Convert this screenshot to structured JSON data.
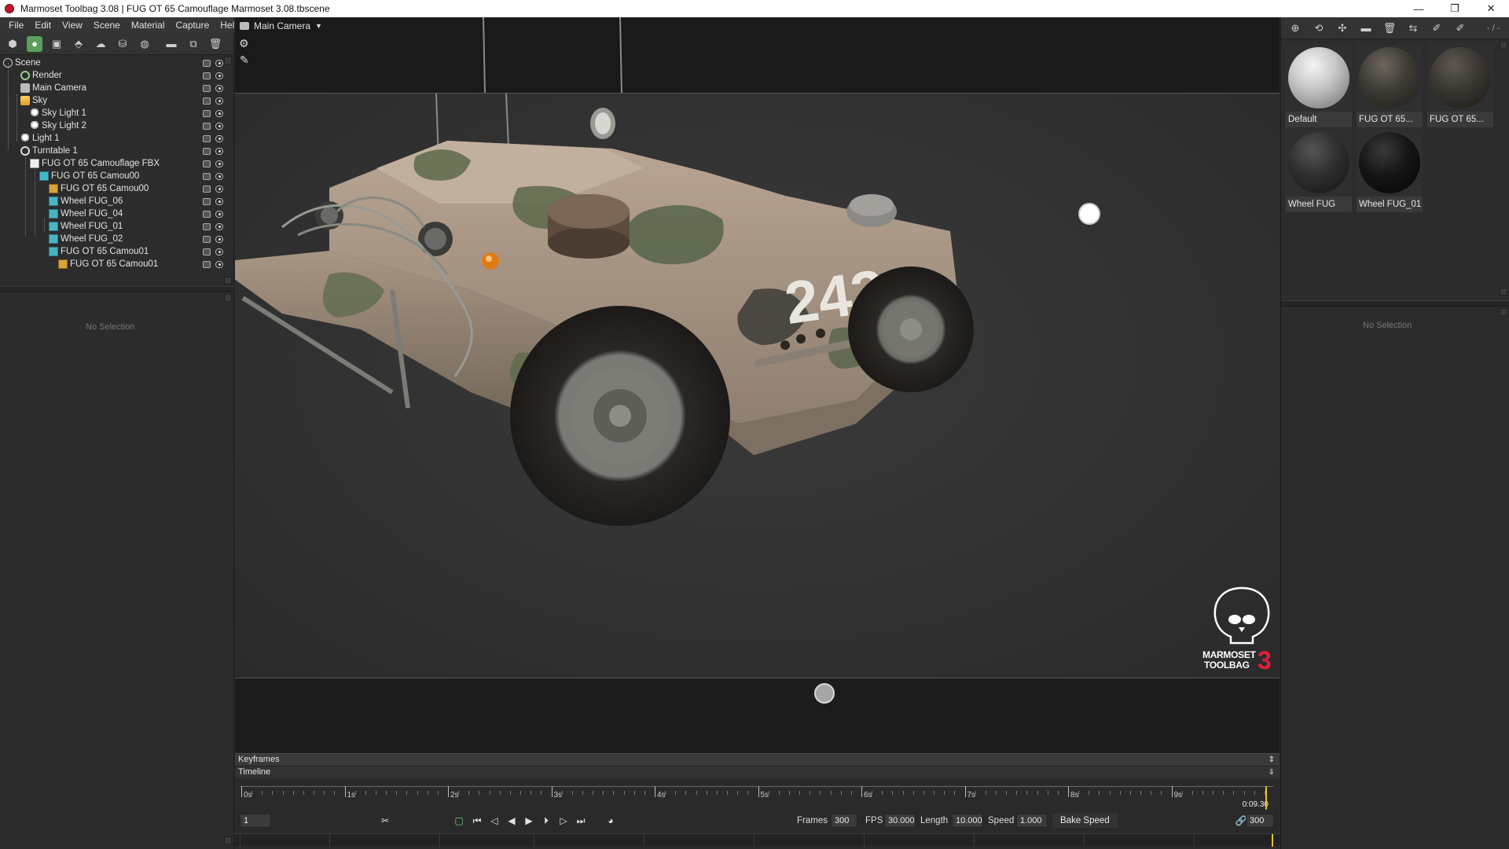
{
  "window": {
    "title": "Marmoset Toolbag 3.08  |  FUG OT 65 Camouflage Marmoset 3.08.tbscene",
    "minimize": "—",
    "maximize": "❐",
    "close": "✕"
  },
  "menu": [
    "File",
    "Edit",
    "View",
    "Scene",
    "Material",
    "Capture",
    "Help"
  ],
  "scene_tree": [
    {
      "label": "Scene",
      "icon": "scene"
    },
    {
      "label": "Render",
      "icon": "gear"
    },
    {
      "label": "Main Camera",
      "icon": "cam"
    },
    {
      "label": "Sky",
      "icon": "sky"
    },
    {
      "label": "Sky Light 1",
      "icon": "light"
    },
    {
      "label": "Sky Light 2",
      "icon": "light"
    },
    {
      "label": "Light 1",
      "icon": "light"
    },
    {
      "label": "Turntable 1",
      "icon": "turn"
    },
    {
      "label": "FUG OT 65 Camouflage FBX",
      "icon": "fbx"
    },
    {
      "label": "FUG OT 65 Camou00",
      "icon": "cube"
    },
    {
      "label": "FUG OT 65 Camou00",
      "icon": "cube-o"
    },
    {
      "label": "Wheel FUG_06",
      "icon": "cube"
    },
    {
      "label": "Wheel FUG_04",
      "icon": "cube"
    },
    {
      "label": "Wheel FUG_01",
      "icon": "cube"
    },
    {
      "label": "Wheel FUG_02",
      "icon": "cube"
    },
    {
      "label": "FUG OT 65 Camou01",
      "icon": "cube"
    },
    {
      "label": "FUG OT 65 Camou01",
      "icon": "cube-o"
    }
  ],
  "left_properties": {
    "empty_text": "No Selection"
  },
  "viewport": {
    "camera_label": "Main Camera",
    "vehicle_number": "243",
    "logo_line1": "MARMOSET",
    "logo_line2": "TOOLBAG",
    "logo_version": "3"
  },
  "materials": [
    {
      "label": "Default",
      "style": "default"
    },
    {
      "label": "FUG OT 65...",
      "style": "camo-dark"
    },
    {
      "label": "FUG OT 65...",
      "style": "camo-dark"
    },
    {
      "label": "Wheel FUG",
      "style": "tire"
    },
    {
      "label": "Wheel FUG_01",
      "style": "black"
    }
  ],
  "right_toolbar_text": "- / -",
  "right_properties": {
    "empty_text": "No Selection"
  },
  "timeline": {
    "keyframes_label": "Keyframes",
    "timeline_label": "Timeline",
    "ticks": [
      "0s",
      "1s",
      "2s",
      "3s",
      "4s",
      "5s",
      "6s",
      "7s",
      "8s",
      "9s"
    ],
    "time_readout": "0:09.30",
    "current_frame": "1",
    "frames_label": "Frames",
    "frames_value": "300",
    "fps_label": "FPS",
    "fps_value": "30.000",
    "length_label": "Length",
    "length_value": "10.000",
    "speed_label": "Speed",
    "speed_value": "1.000",
    "bake_label": "Bake Speed",
    "end_frame": "300"
  }
}
